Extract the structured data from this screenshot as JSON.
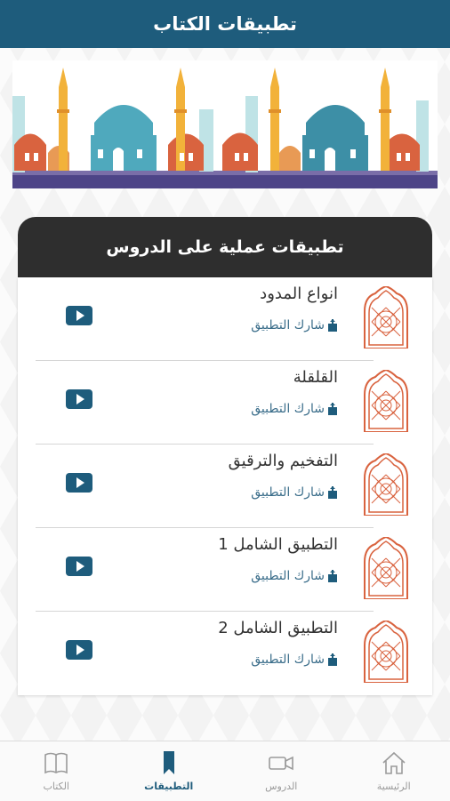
{
  "app": {
    "title": "تطبيقات الكتاب"
  },
  "section": {
    "title": "تطبيقات عملية على الدروس"
  },
  "share_label": "شارك التطبيق",
  "lessons": [
    {
      "title": "انواع المدود"
    },
    {
      "title": "القلقلة"
    },
    {
      "title": "التفخيم والترقيق"
    },
    {
      "title": "التطبيق الشامل 1"
    },
    {
      "title": "التطبيق الشامل 2"
    }
  ],
  "nav": {
    "book": "الكتاب",
    "apps": "التطبيقات",
    "lessons": "الدروس",
    "home": "الرئيسية"
  },
  "colors": {
    "primary": "#1e5c7c",
    "header_dark": "#2e2e2e",
    "accent_orange": "#d9633f"
  }
}
